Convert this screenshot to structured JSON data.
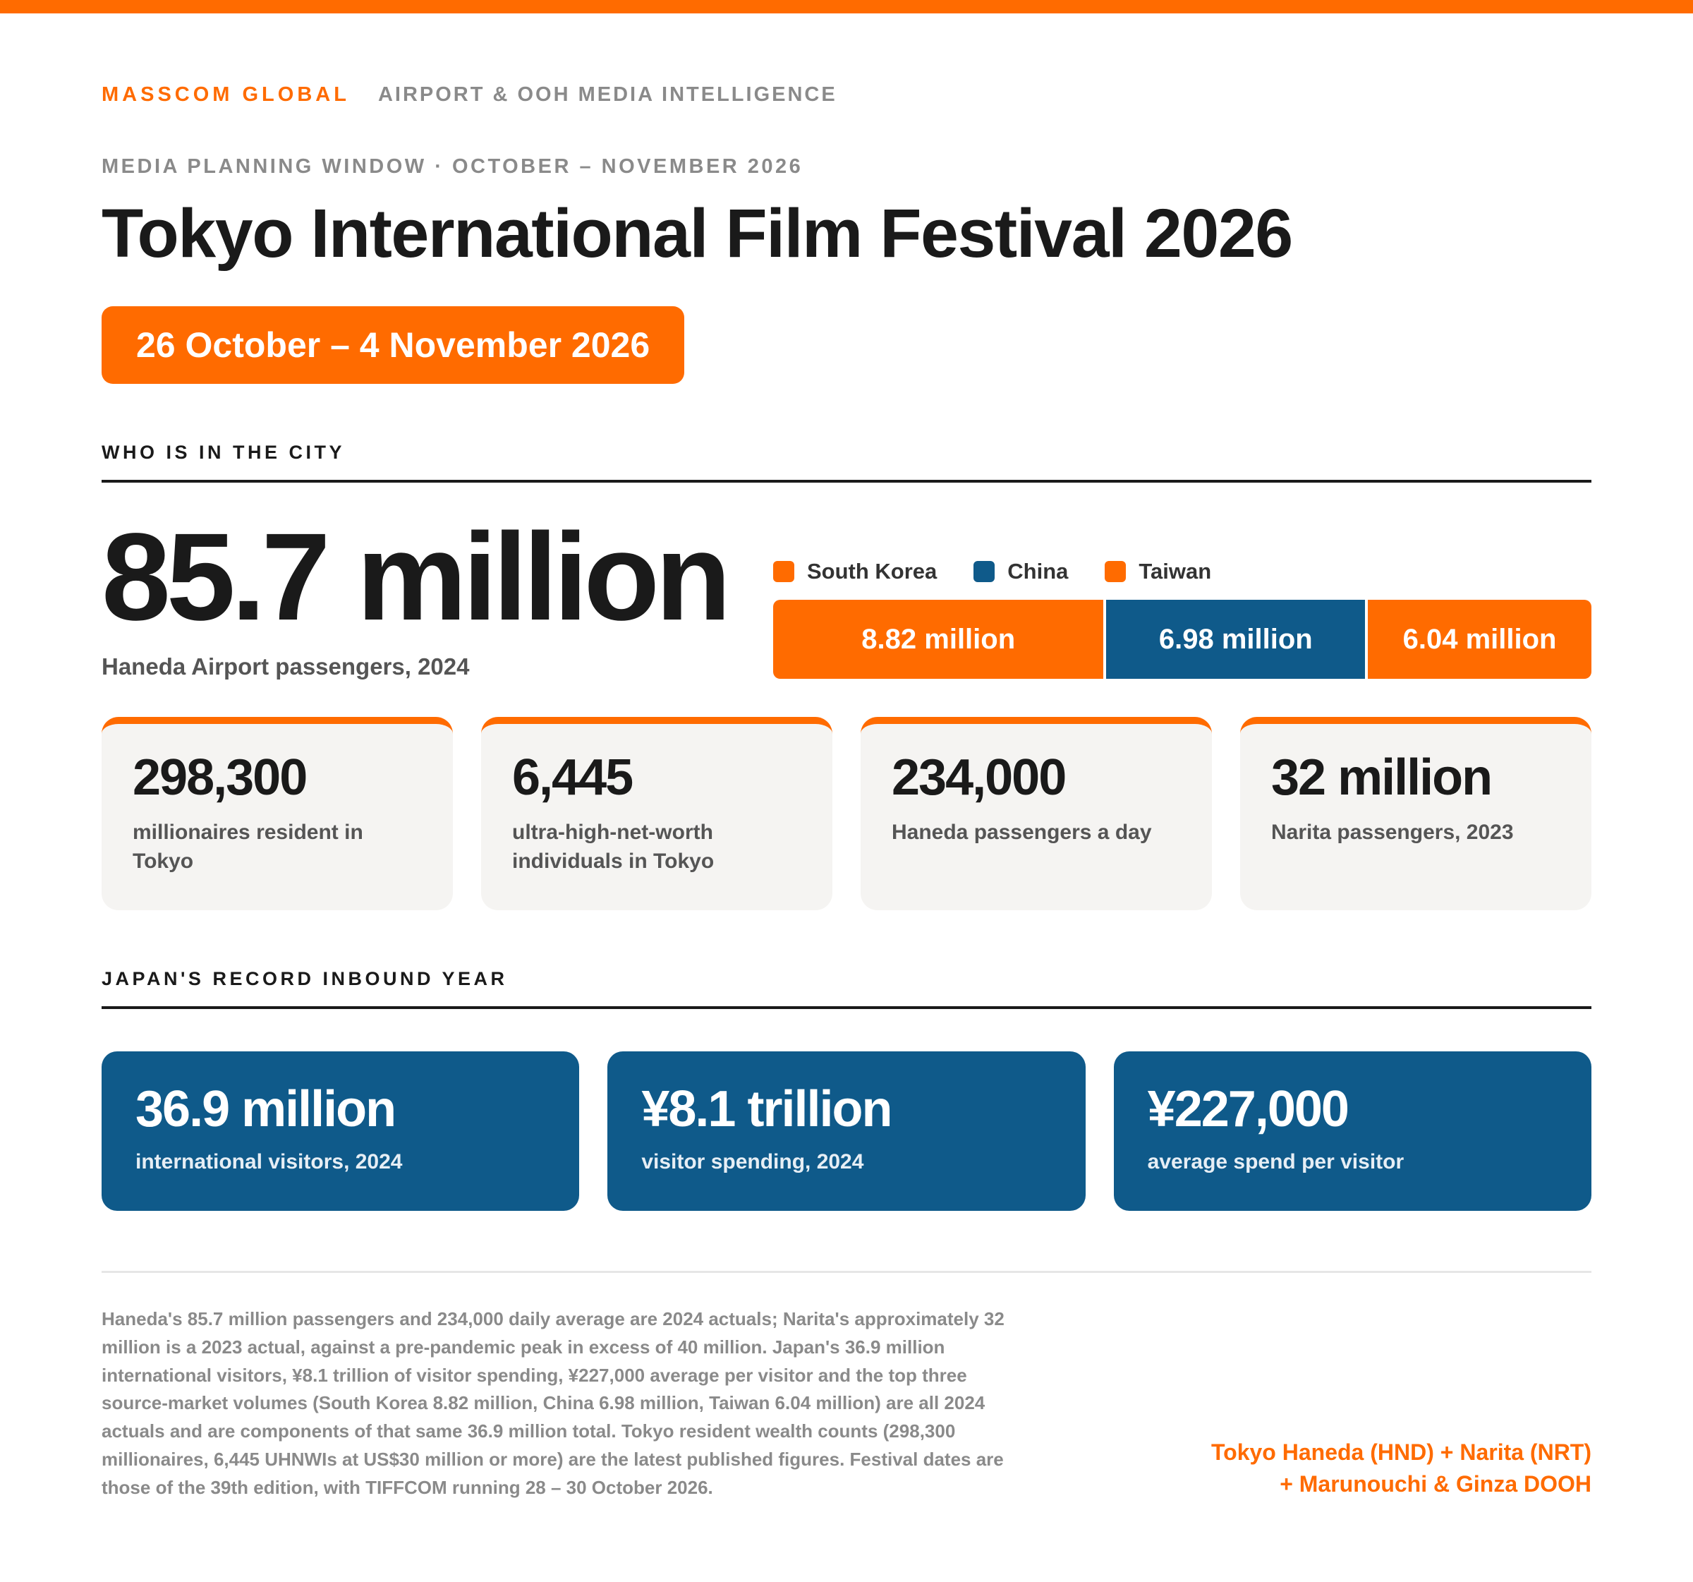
{
  "colors": {
    "accent": "#ff6b00",
    "navy": "#0f5a8a",
    "ink": "#1a1a1a",
    "muted": "#8a8a8a"
  },
  "header": {
    "brand": "MASSCOM GLOBAL",
    "brand_tagline": "AIRPORT & OOH MEDIA INTELLIGENCE",
    "kicker": "MEDIA PLANNING WINDOW · OCTOBER – NOVEMBER 2026",
    "title": "Tokyo International Film Festival 2026",
    "dates": "26 October – 4 November 2026"
  },
  "city": {
    "section_label": "WHO IS IN THE CITY",
    "hero_value": "85.7 million",
    "hero_label": "Haneda Airport passengers, 2024",
    "markets": [
      {
        "name": "South Korea",
        "value_label": "8.82 million",
        "value": 8.82,
        "color": "#ff6b00"
      },
      {
        "name": "China",
        "value_label": "6.98 million",
        "value": 6.98,
        "color": "#0f5a8a"
      },
      {
        "name": "Taiwan",
        "value_label": "6.04 million",
        "value": 6.04,
        "color": "#ff6b00"
      }
    ],
    "cards": [
      {
        "value": "298,300",
        "label": "millionaires resident in Tokyo"
      },
      {
        "value": "6,445",
        "label": "ultra-high-net-worth individuals in Tokyo"
      },
      {
        "value": "234,000",
        "label": "Haneda passengers a day"
      },
      {
        "value": "32 million",
        "label": "Narita passengers, 2023"
      }
    ]
  },
  "inbound": {
    "section_label": "JAPAN'S RECORD INBOUND YEAR",
    "cards": [
      {
        "value": "36.9 million",
        "label": "international visitors, 2024"
      },
      {
        "value": "¥8.1 trillion",
        "label": "visitor spending, 2024"
      },
      {
        "value": "¥227,000",
        "label": "average spend per visitor"
      }
    ]
  },
  "footer": {
    "note": "Haneda's 85.7 million passengers and 234,000 daily average are 2024 actuals; Narita's approximately 32 million is a 2023 actual, against a pre-pandemic peak in excess of 40 million. Japan's 36.9 million international visitors, ¥8.1 trillion of visitor spending, ¥227,000 average per visitor and the top three source-market volumes (South Korea 8.82 million, China 6.98 million, Taiwan 6.04 million) are all 2024 actuals and are components of that same 36.9 million total. Tokyo resident wealth counts (298,300 millionaires, 6,445 UHNWIs at US$30 million or more) are the latest published figures. Festival dates are those of the 39th edition, with TIFFCOM running 28 – 30 October 2026.",
    "locations_line1": "Tokyo Haneda (HND) + Narita (NRT)",
    "locations_line2": "+ Marunouchi & Ginza DOOH"
  }
}
